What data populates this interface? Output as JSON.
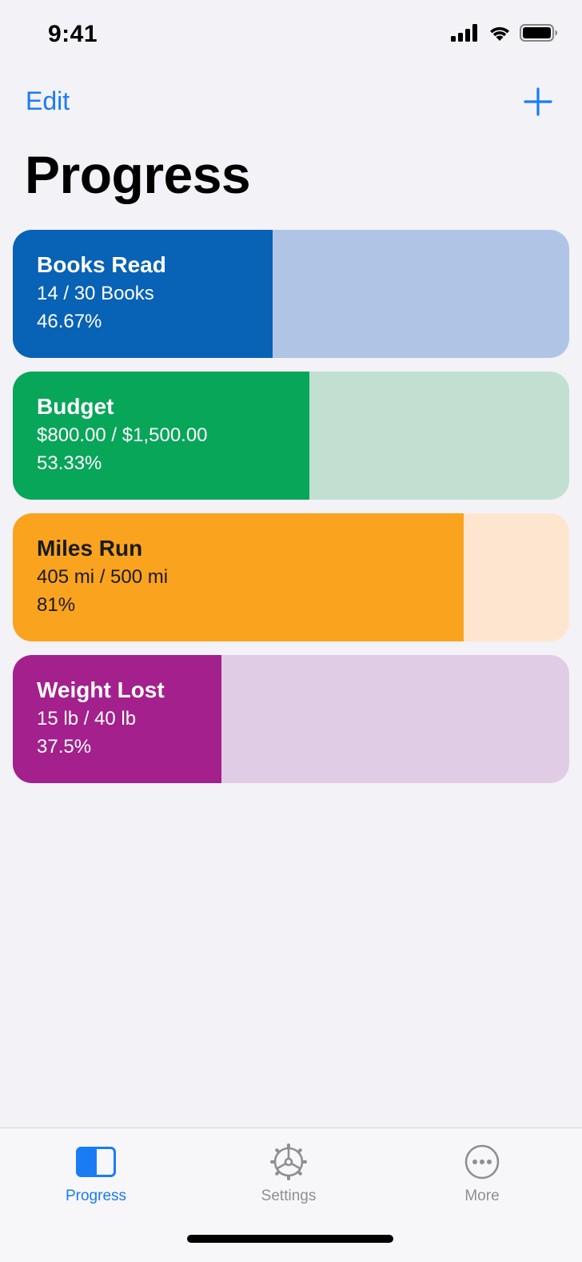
{
  "status_bar": {
    "time": "9:41"
  },
  "nav": {
    "edit_label": "Edit",
    "add_icon": "plus-icon"
  },
  "page_title": "Progress",
  "cards": [
    {
      "title": "Books Read",
      "detail": "14 / 30 Books",
      "percent_text": "46.67%",
      "progress": 0.4667,
      "fill_color": "#0862b5",
      "track_color": "#b0c5e5",
      "text_color": "#ffffff"
    },
    {
      "title": "Budget",
      "detail": "$800.00 / $1,500.00",
      "percent_text": "53.33%",
      "progress": 0.5333,
      "fill_color": "#08a659",
      "track_color": "#c1e0d2",
      "text_color": "#ffffff"
    },
    {
      "title": "Miles Run",
      "detail": "405 mi / 500 mi",
      "percent_text": "81%",
      "progress": 0.81,
      "fill_color": "#faa31f",
      "track_color": "#fee5d0",
      "text_color": "#1a1a1a"
    },
    {
      "title": "Weight Lost",
      "detail": "15 lb / 40 lb",
      "percent_text": "37.5%",
      "progress": 0.375,
      "fill_color": "#a3208d",
      "track_color": "#e1cce5",
      "text_color": "#ffffff"
    }
  ],
  "tab_bar": {
    "active_color": "#1a7cf5",
    "inactive_color": "#8e8e93",
    "tabs": [
      {
        "label": "Progress",
        "icon": "progress-icon",
        "active": true
      },
      {
        "label": "Settings",
        "icon": "gear-icon",
        "active": false
      },
      {
        "label": "More",
        "icon": "more-icon",
        "active": false
      }
    ]
  }
}
